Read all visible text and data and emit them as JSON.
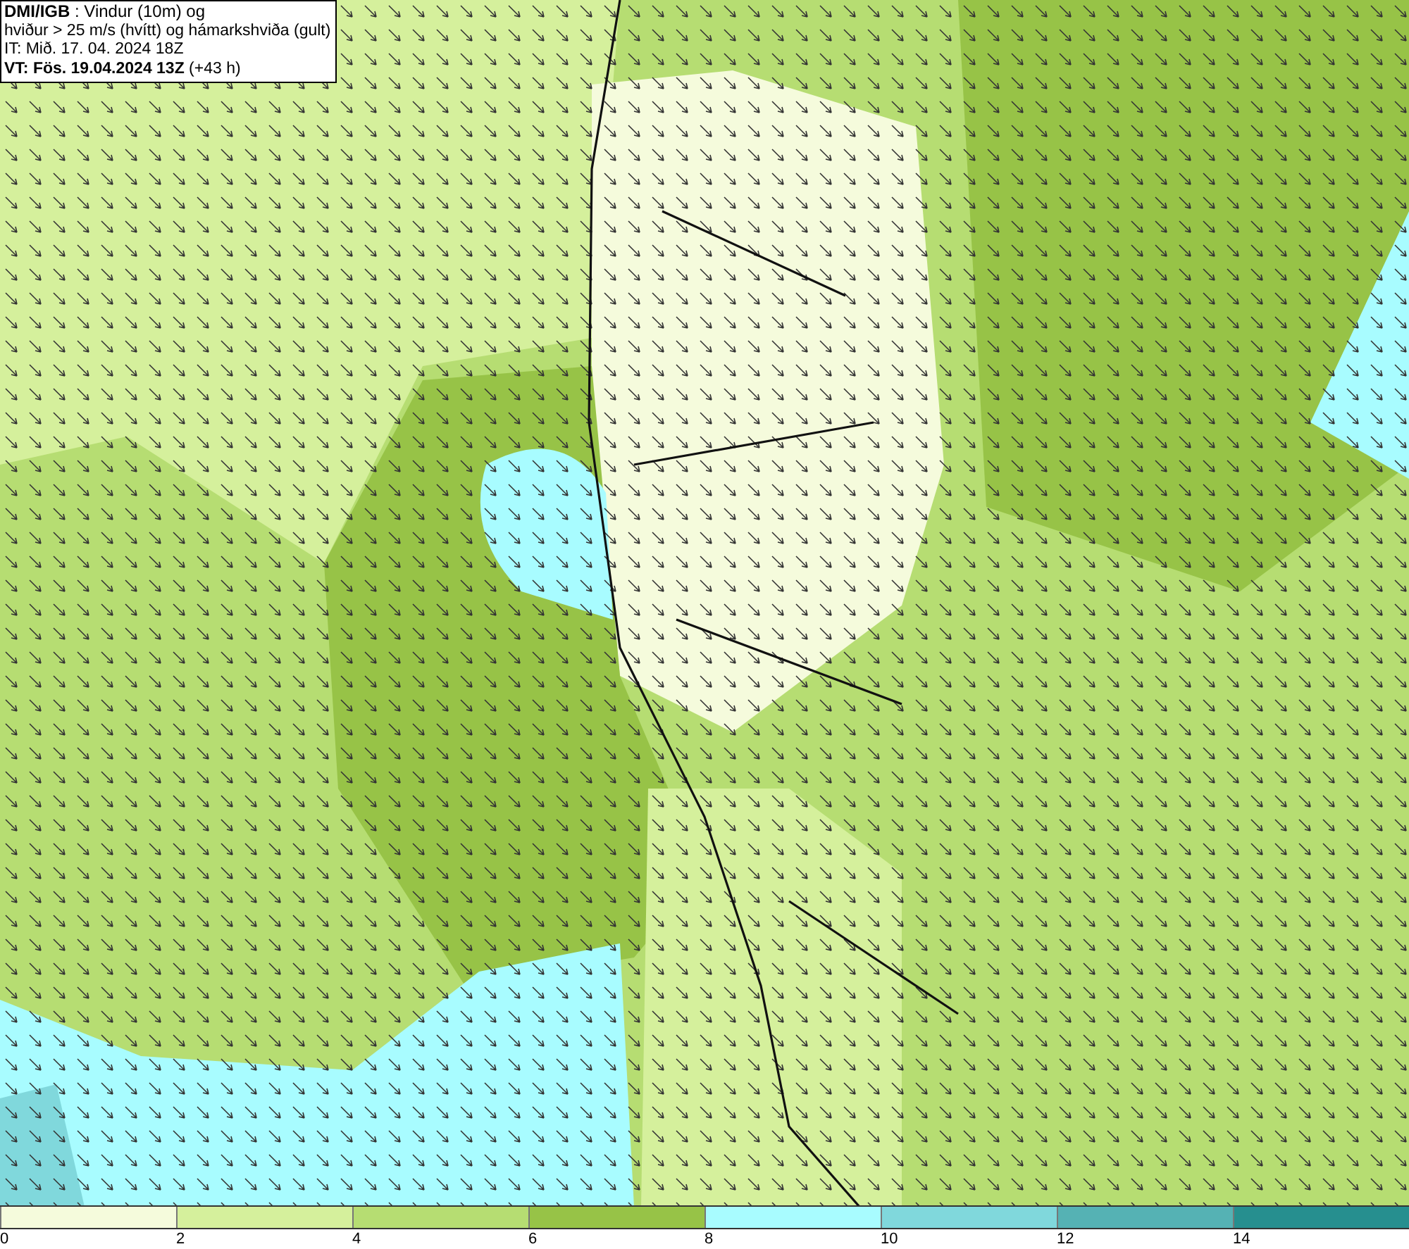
{
  "info_box": {
    "lines": [
      "**DMI/IGB** : Vindur (10m) og",
      "hviður > 25 m/s (hvítt) og hámarkshviða (gult)",
      "IT: Mið. 17. 04. 2024 18Z",
      "**VT: Fös. 19.04.2024 13Z** (+43 h)"
    ]
  },
  "legend": {
    "segments": [
      {
        "color": "#f5fbdc"
      },
      {
        "color": "#d5f09c"
      },
      {
        "color": "#b6dd72"
      },
      {
        "color": "#97c347"
      },
      {
        "color": "#a8fcff"
      },
      {
        "color": "#80d8dc"
      },
      {
        "color": "#55b2b4"
      },
      {
        "color": "#268f8f"
      }
    ],
    "labels": [
      "0",
      "2",
      "4",
      "6",
      "8",
      "10",
      "12",
      "14"
    ]
  }
}
